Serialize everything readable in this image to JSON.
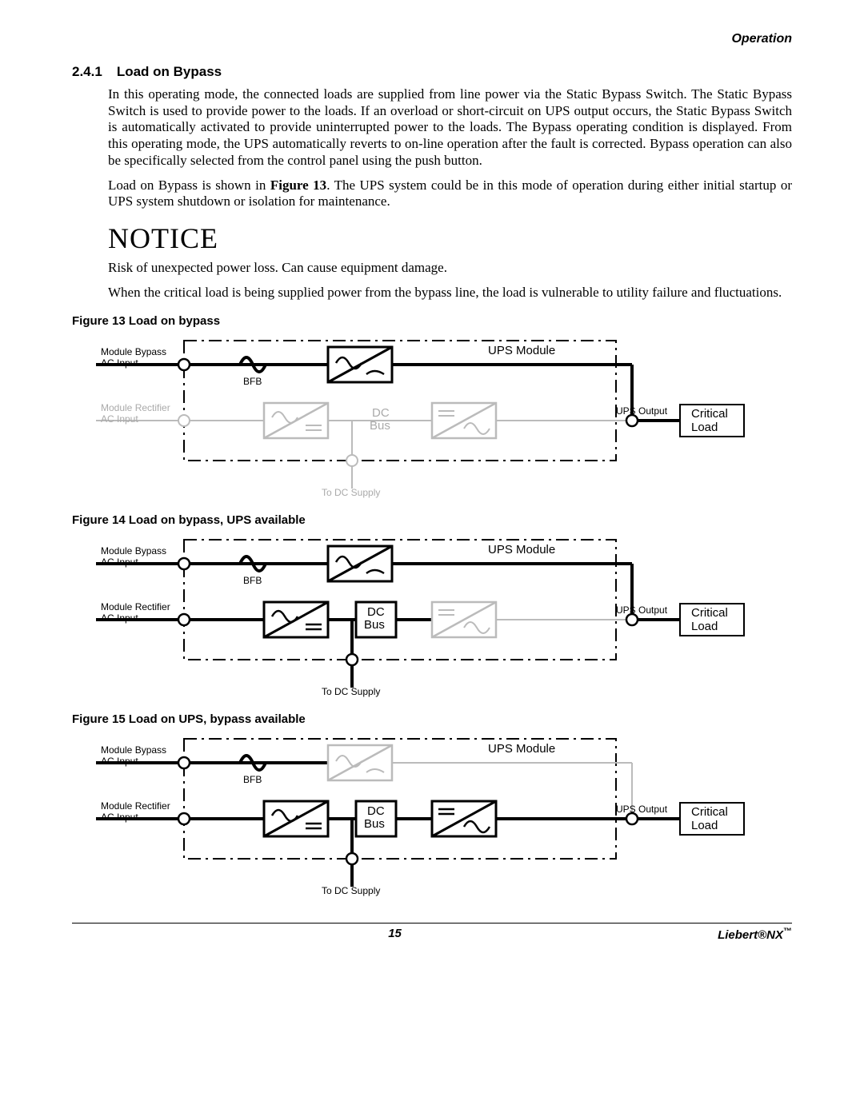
{
  "header": {
    "section": "Operation"
  },
  "section": {
    "number": "2.4.1",
    "title": "Load on Bypass"
  },
  "para1": "In this operating mode, the connected loads are supplied from line power via the Static Bypass Switch. The Static Bypass Switch is used to provide power to the loads. If an overload or short-circuit on UPS output occurs, the Static Bypass Switch is automatically activated to provide uninterrupted power to the loads. The Bypass operating condition is displayed. From this operating mode, the UPS automatically reverts to on-line operation after the fault is corrected. Bypass operation can also be specifically selected from the control panel using the push button.",
  "para2a": "Load on Bypass is shown in ",
  "para2b": "Figure 13",
  "para2c": ". The UPS system could be in this mode of operation during either initial startup or UPS system shutdown or isolation for maintenance.",
  "notice": {
    "title": "NOTICE",
    "line1": "Risk of unexpected power loss. Can cause equipment damage.",
    "line2": "When the critical load is being supplied power from the bypass line, the load is vulnerable to utility failure and fluctuations."
  },
  "fig13": {
    "caption": "Figure 13   Load on bypass"
  },
  "fig14": {
    "caption": "Figure 14   Load on bypass, UPS available"
  },
  "fig15": {
    "caption": "Figure 15   Load on UPS, bypass available"
  },
  "labels": {
    "ups_module": "UPS Module",
    "module_bypass": "Module Bypass",
    "ac_input": "AC Input",
    "module_rectifier": "Module Rectifier",
    "bfb": "BFB",
    "dc_bus1": "DC",
    "dc_bus2": "Bus",
    "ups_output": "UPS Output",
    "critical": "Critical",
    "load": "Load",
    "to_dc_supply": "To DC Supply"
  },
  "footer": {
    "page": "15",
    "brand": "Liebert®NX",
    "tm": "™"
  }
}
